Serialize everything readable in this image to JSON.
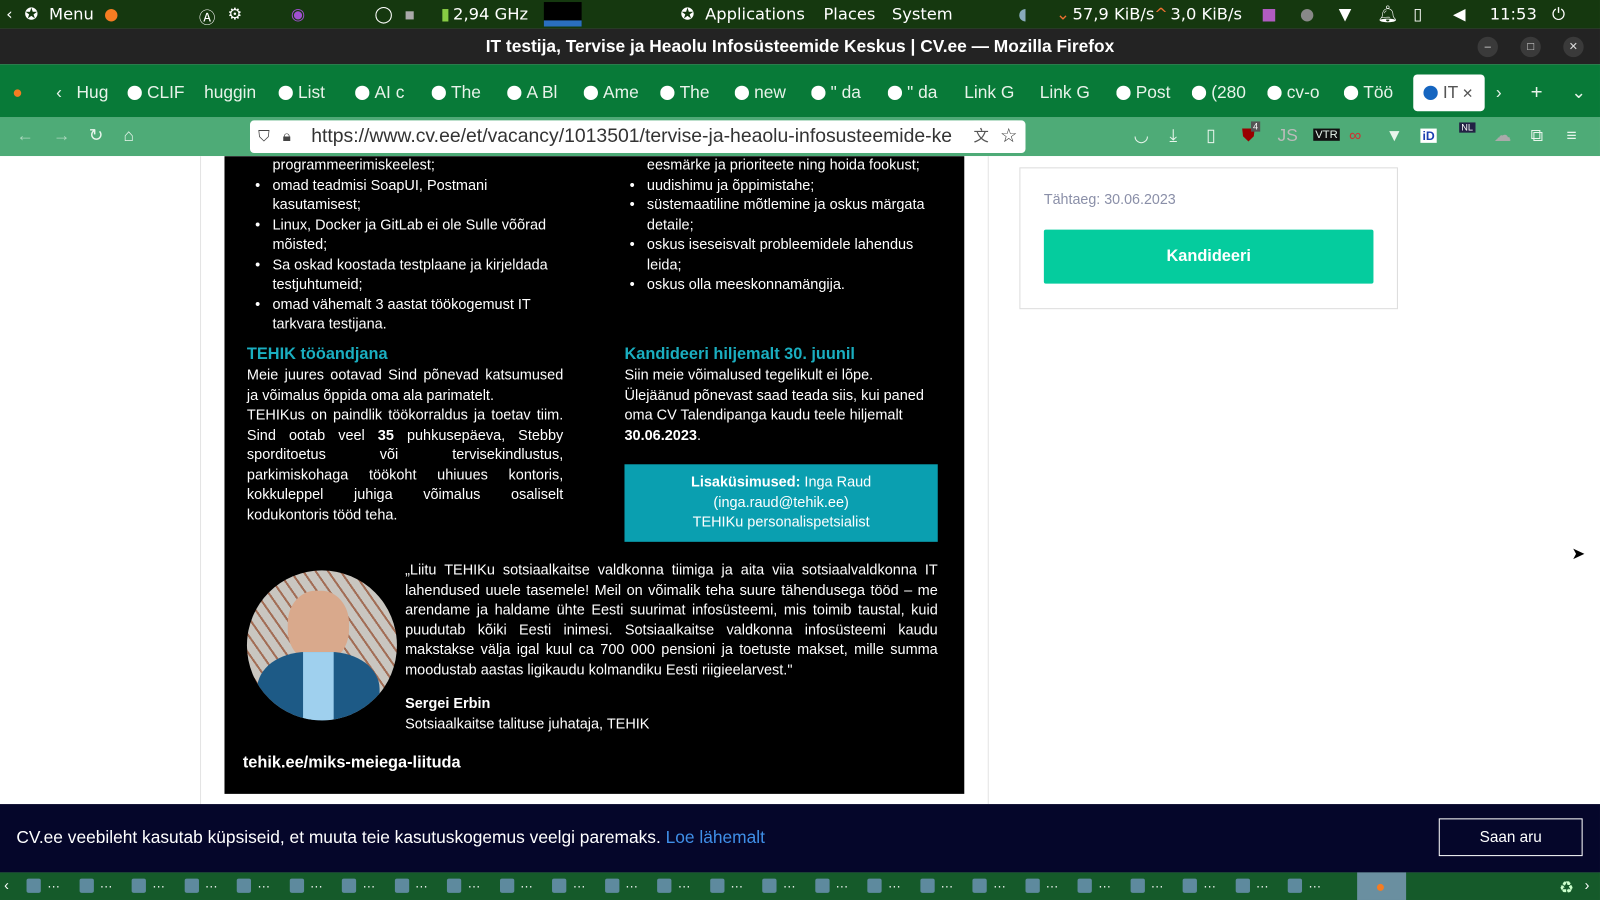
{
  "system_panel": {
    "menu_label": "Menu",
    "cpu_freq": "2,94 GHz",
    "menus": [
      "Applications",
      "Places",
      "System"
    ],
    "net_down": "57,9 KiB/s",
    "net_up": "3,0 KiB/s",
    "clock": "11:53"
  },
  "window": {
    "title": "IT testija, Tervise ja Heaolu Infosüsteemide Keskus | CV.ee — Mozilla Firefox"
  },
  "tabs": [
    {
      "label": "Hug"
    },
    {
      "label": "CLIF"
    },
    {
      "label": "huggin"
    },
    {
      "label": "List"
    },
    {
      "label": "AI c"
    },
    {
      "label": "The"
    },
    {
      "label": "A Bl"
    },
    {
      "label": "Ame"
    },
    {
      "label": "The"
    },
    {
      "label": "new"
    },
    {
      "label": "\" da"
    },
    {
      "label": "\" da"
    },
    {
      "label": "Link G"
    },
    {
      "label": "Link G"
    },
    {
      "label": "Post"
    },
    {
      "label": "(280"
    },
    {
      "label": "cv-o"
    },
    {
      "label": "Töö"
    },
    {
      "label": "IT",
      "active": true
    }
  ],
  "navbar": {
    "url": "https://www.cv.ee/et/vacancy/1013501/tervise-ja-heaolu-infosusteemide-ke",
    "ublock_badge": "4",
    "nl_badge": "NL"
  },
  "poster": {
    "left_list_top": "programmeerimiskeelest;",
    "left_list": [
      "omad teadmisi SoapUI, Postmani kasutamisest;",
      "Linux, Docker ja GitLab ei ole Sulle võõrad mõisted;",
      "Sa oskad koostada testplaane ja kirjeldada testjuhtumeid;",
      "omad vähemalt 3 aastat töökogemust IT tarkvara testijana."
    ],
    "right_list_top": "eesmärke ja prioriteete ning hoida fookust;",
    "right_list": [
      "uudishimu ja õppimistahe;",
      "süstemaatiline mõtlemine ja oskus märgata detaile;",
      "oskus iseseisvalt probleemidele lahendus leida;",
      "oskus olla meeskonnamängija."
    ],
    "employer_heading": "TEHIK tööandjana",
    "employer_p1": "Meie juures ootavad Sind põnevad katsumused ja võimalus õppida oma ala parimatelt.",
    "employer_p2a": "TEHIKus on paindlik töökorraldus ja toetav tiim. Sind ootab veel ",
    "employer_p2b": "35",
    "employer_p2c": " puhkusepäeva, Stebby sporditoetus või tervisekindlustus, parkimiskohaga töökoht uhiuues kontoris, kokkuleppel juhiga võimalus osaliselt kodukontoris tööd teha.",
    "apply_heading": "Kandideeri hiljemalt 30. juunil",
    "apply_p": "Siin meie võimalused tegelikult ei lõpe. Ülejäänud põnevast saad teada siis, kui paned oma CV Talendipanga kaudu teele hiljemalt ",
    "apply_date": "30.06.2023",
    "contact_label": "Lisaküsimused:",
    "contact_name": "Inga Raud",
    "contact_email": "(inga.raud@tehik.ee)",
    "contact_role": "TEHIKu personalispetsialist",
    "quote": "„Liitu TEHIKu sotsiaalkaitse valdkonna tiimiga ja aita viia sotsiaalvaldkonna IT lahendused uuele tasemele! Meil on võimalik teha suure tähendusega tööd – me arendame ja haldame ühte Eesti suurimat infosüsteemi, mis toimib taustal, kuid puudutab kõiki Eesti inimesi. Sotsiaalkaitse valdkonna infosüsteemi kaudu makstakse välja igal kuul ca 700 000 pensioni ja toetuste makset, mille summa moodustab aastas ligikaudu kolmandiku Eesti riigieelarvest.\"",
    "quote_author": "Sergei Erbin",
    "quote_author_role": "Sotsiaalkaitse talituse juhataja, TEHIK",
    "link": "tehik.ee/miks-meiega-liituda"
  },
  "sidebar_card": {
    "deadline": "Tähtaeg: 30.06.2023",
    "apply_button": "Kandideeri"
  },
  "cookie_bar": {
    "text": "CV.ee veebileht kasutab küpsiseid, et muuta teie kasutuskogemus veelgi paremaks.",
    "link": "Loe lähemalt",
    "button": "Saan aru"
  },
  "colors": {
    "accent_teal": "#1aaec0",
    "apply_green": "#05cc9e",
    "browser_green": "#087a38",
    "cookie_bg": "#05062a",
    "link_blue": "#3f8fe8"
  }
}
